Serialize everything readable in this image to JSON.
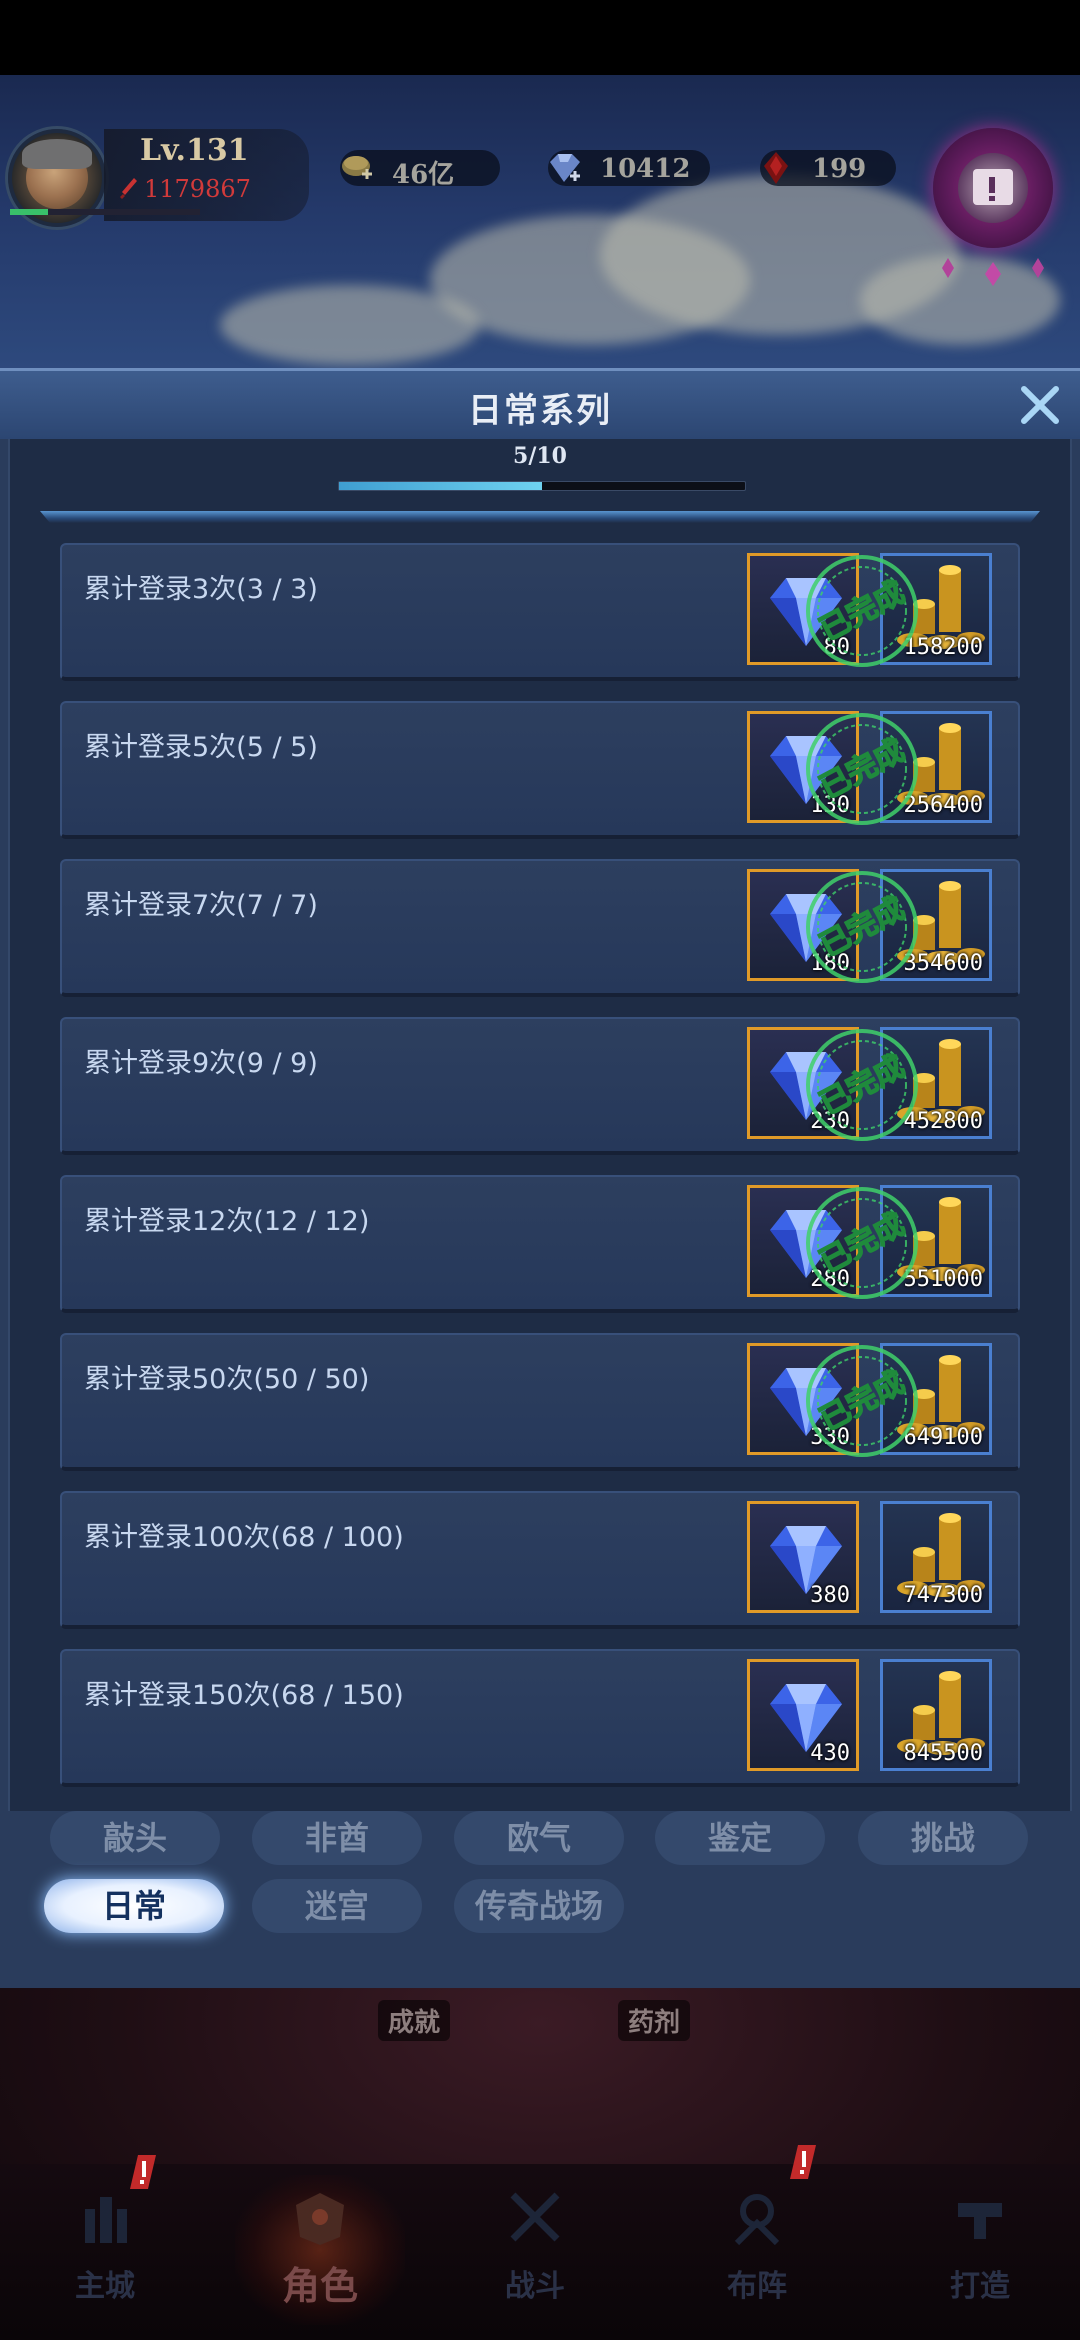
{
  "player": {
    "level": "Lv.131",
    "power": "1179867",
    "exp_fraction": 0.2
  },
  "resources": {
    "gold": "46亿",
    "diamond": "10412",
    "ruby": "199"
  },
  "modal": {
    "title": "日常系列",
    "progress_text": "5/10",
    "progress_fraction": 0.5,
    "stamp_text": "已完成",
    "rows": [
      {
        "label": "累计登录3次(3 / 3)",
        "diamond_qty": "80",
        "gold_qty": "158200",
        "completed": true
      },
      {
        "label": "累计登录5次(5 / 5)",
        "diamond_qty": "130",
        "gold_qty": "256400",
        "completed": true
      },
      {
        "label": "累计登录7次(7 / 7)",
        "diamond_qty": "180",
        "gold_qty": "354600",
        "completed": true
      },
      {
        "label": "累计登录9次(9 / 9)",
        "diamond_qty": "230",
        "gold_qty": "452800",
        "completed": true
      },
      {
        "label": "累计登录12次(12 / 12)",
        "diamond_qty": "280",
        "gold_qty": "551000",
        "completed": true
      },
      {
        "label": "累计登录50次(50 / 50)",
        "diamond_qty": "330",
        "gold_qty": "649100",
        "completed": true
      },
      {
        "label": "累计登录100次(68 / 100)",
        "diamond_qty": "380",
        "gold_qty": "747300",
        "completed": false
      },
      {
        "label": "累计登录150次(68 / 150)",
        "diamond_qty": "430",
        "gold_qty": "845500",
        "completed": false
      }
    ]
  },
  "tabs": {
    "row1": [
      "敲头",
      "非酋",
      "欧气",
      "鉴定",
      "挑战"
    ],
    "row2": [
      "日常",
      "迷宫",
      "传奇战场"
    ],
    "active": "日常"
  },
  "background_labels": {
    "left": "成就",
    "right": "药剂"
  },
  "nav": {
    "items": [
      "主城",
      "角色",
      "战斗",
      "布阵",
      "打造"
    ],
    "active": "角色"
  },
  "colors": {
    "accent": "#6fd2f0",
    "diamond_border": "#e09a28",
    "gold_border": "#4a7fd0",
    "stamp": "#3fd06a"
  }
}
